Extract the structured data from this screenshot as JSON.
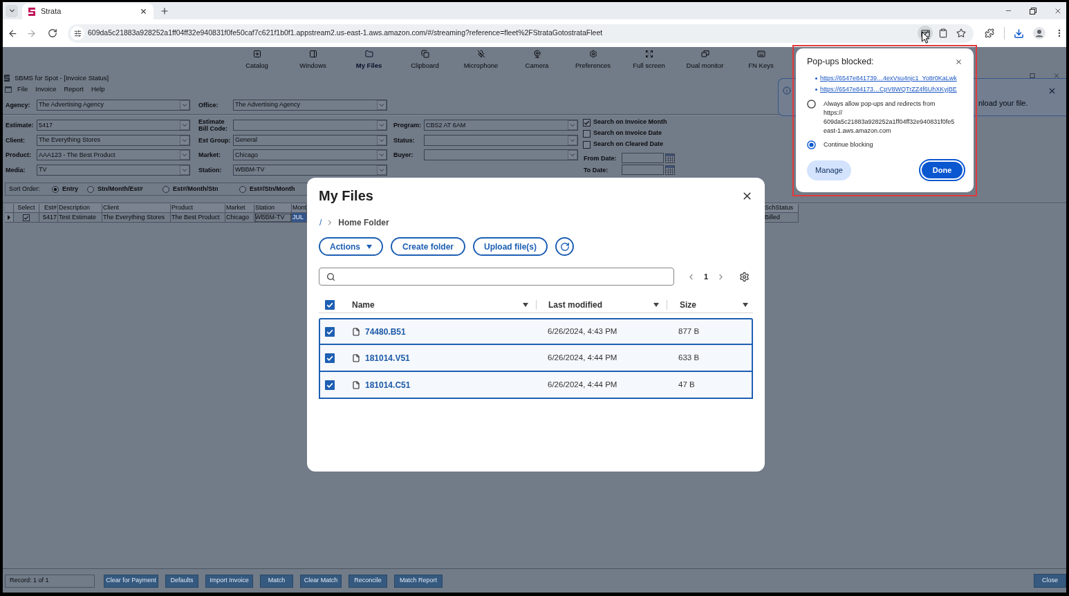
{
  "browser": {
    "tab": {
      "title": "Strata"
    },
    "address": "609da5c21883a928252a1ff04ff32e940831f0fe50caf7c621f1b0f1.appstream2.us-east-1.aws.amazon.com/#/streaming?reference=fleet%2FStrataGotostrataFleet"
  },
  "streaming_toolbar": [
    {
      "label": "Catalog",
      "selected": false
    },
    {
      "label": "Windows",
      "selected": false
    },
    {
      "label": "My Files",
      "selected": true
    },
    {
      "label": "Clipboard",
      "selected": false
    },
    {
      "label": "Microphone",
      "selected": false
    },
    {
      "label": "Camera",
      "selected": false
    },
    {
      "label": "Preferences",
      "selected": false
    },
    {
      "label": "Full screen",
      "selected": false
    },
    {
      "label": "Dual monitor",
      "selected": false
    },
    {
      "label": "FN Keys",
      "selected": false
    }
  ],
  "app": {
    "title": "SBMS for Spot - [Invoice Status]",
    "menu": [
      "File",
      "Invoice",
      "Report",
      "Help"
    ],
    "header_fields": [
      {
        "label": "Agency:",
        "value": "The Advertising Agency"
      },
      {
        "label": "Office:",
        "value": "The Advertising Agency"
      }
    ],
    "filter_columns": [
      [
        {
          "label": "Estimate:",
          "value": "5417"
        },
        {
          "label": "Client:",
          "value": "The Everything Stores"
        },
        {
          "label": "Product:",
          "value": "AAA123 - The Best Product"
        },
        {
          "label": "Media:",
          "value": "TV"
        }
      ],
      [
        {
          "label": "Estimate Bill Code:"
        },
        {
          "label": "Est Group:",
          "value": "General"
        },
        {
          "label": "Market:",
          "value": "Chicago"
        },
        {
          "label": "Station:",
          "value": "WBBM-TV"
        }
      ],
      [
        {
          "label": "Program:",
          "value": "CBS2 AT 6AM"
        },
        {
          "label": "Status:"
        },
        {
          "label": "Buyer:"
        }
      ]
    ],
    "search_options": [
      {
        "label": "Search on Invoice Month",
        "checked": true
      },
      {
        "label": "Search on Invoice Date",
        "checked": false
      },
      {
        "label": "Search on Cleared Date",
        "checked": false
      }
    ],
    "date_fields": [
      {
        "label": "From Date:"
      },
      {
        "label": "To Date:"
      }
    ],
    "sort_order": {
      "label": "Sort Order:",
      "options": [
        {
          "label": "Entry",
          "selected": true
        },
        {
          "label": "Stn/Month/Est#",
          "selected": false
        },
        {
          "label": "Est#/Month/Stn",
          "selected": false
        },
        {
          "label": "Est#/Stn/Month",
          "selected": false
        }
      ]
    },
    "grid": {
      "columns": [
        "Select",
        "Est#",
        "Description",
        "Client",
        "Product",
        "Market",
        "Station",
        "Mont",
        "SchStatus"
      ],
      "rows": [
        {
          "current": true,
          "cells": [
            {
              "kind": "checkbox",
              "checked": true
            },
            {
              "kind": "text",
              "text": "5417",
              "selected": false,
              "focused": false
            },
            {
              "kind": "text",
              "text": "Test Estimate",
              "selected": false,
              "focused": false
            },
            {
              "kind": "text",
              "text": "The Everything Stores",
              "selected": false,
              "focused": false
            },
            {
              "kind": "text",
              "text": "The Best Product",
              "selected": false,
              "focused": false
            },
            {
              "kind": "text",
              "text": "Chicago",
              "selected": false,
              "focused": false
            },
            {
              "kind": "text",
              "text": "WBBM-TV",
              "selected": false,
              "focused": true
            },
            {
              "kind": "text",
              "text": "JUL",
              "selected": true,
              "focused": false
            },
            {
              "kind": "text",
              "text": "Billed",
              "selected": false,
              "focused": false
            }
          ]
        }
      ]
    },
    "record": "Record: 1 of 1",
    "buttons": [
      "Clear for Payment",
      "Defaults",
      "Import Invoice",
      "Match",
      "Clear Match",
      "Reconcile",
      "Match Report"
    ],
    "close_button": "Close"
  },
  "notice": {
    "text": "nload your file."
  },
  "my_files": {
    "title": "My Files",
    "breadcrumb": {
      "root": "/",
      "items": [
        "Home Folder"
      ]
    },
    "buttons": [
      {
        "kind": "menu",
        "label": "Actions"
      },
      {
        "kind": "plain",
        "label": "Create folder"
      },
      {
        "kind": "plain",
        "label": "Upload file(s)"
      },
      {
        "kind": "refresh"
      }
    ],
    "page": "1",
    "table": {
      "all_checked": true,
      "columns": [
        "Name",
        "Last modified",
        "Size"
      ],
      "rows": [
        {
          "name": "74480.B51",
          "modified": "6/26/2024, 4:43 PM",
          "size": "877 B",
          "checked": true,
          "selected": true
        },
        {
          "name": "181014.V51",
          "modified": "6/26/2024, 4:44 PM",
          "size": "633 B",
          "checked": true,
          "selected": true
        },
        {
          "name": "181014.C51",
          "modified": "6/26/2024, 4:44 PM",
          "size": "47 B",
          "checked": true,
          "selected": true
        }
      ]
    }
  },
  "popups_blocked": {
    "title": "Pop-ups blocked:",
    "links": [
      "https://6547e841739…4exVsu4njc1_Yo8r0KaLwk",
      "https://6547e84173…CpV8WQTrZZ4f6UhXKyjBE"
    ],
    "options": [
      {
        "label_lines": [
          "Always allow pop-ups and redirects from",
          "https://",
          "609da5c21883a928252a1ff04ff32e940831f0fe5",
          "east-1.aws.amazon.com"
        ],
        "selected": false
      },
      {
        "label_lines": [
          "Continue blocking"
        ],
        "selected": true
      }
    ],
    "buttons": [
      {
        "label": "Manage",
        "kind": "secondary"
      },
      {
        "label": "Done",
        "kind": "primary"
      }
    ]
  }
}
